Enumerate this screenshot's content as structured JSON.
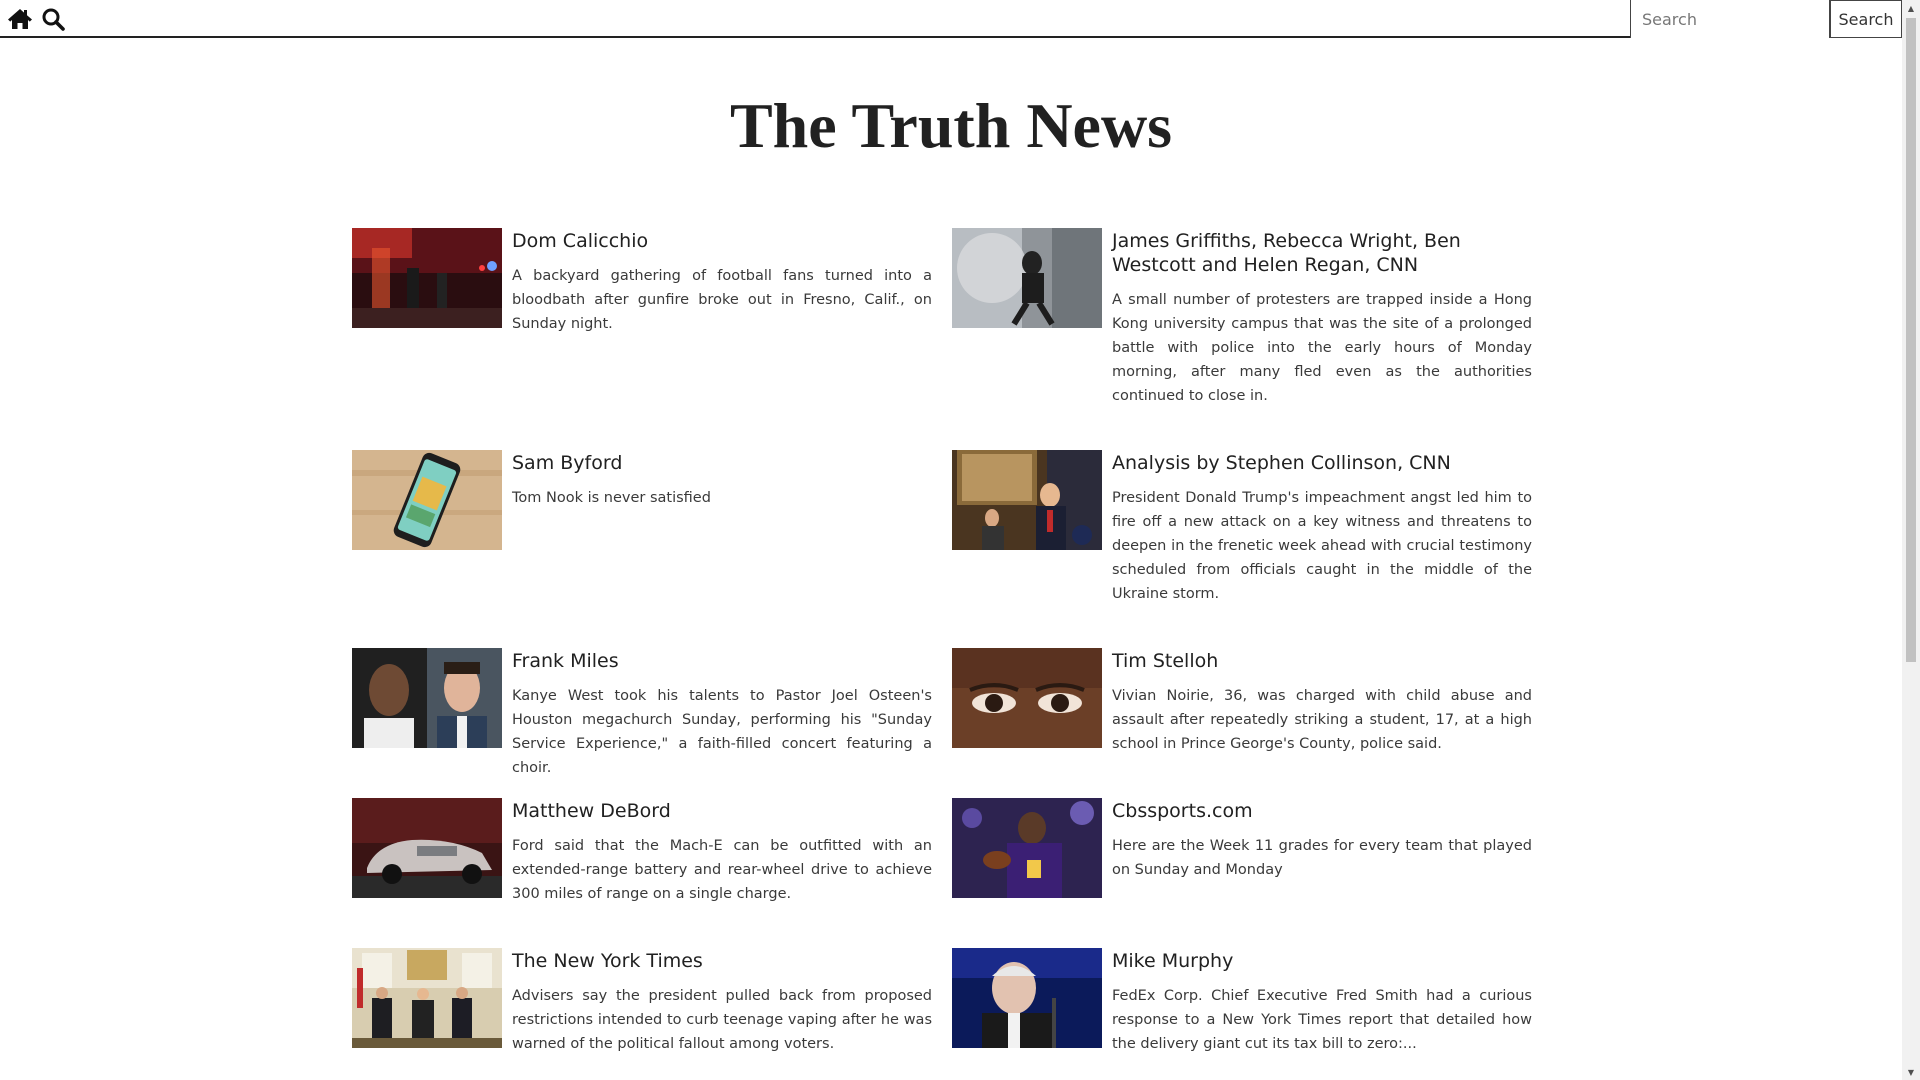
{
  "nav": {
    "home_icon": "home-icon",
    "search_icon": "search-icon",
    "search_placeholder": "Search",
    "search_button": "Search"
  },
  "site_title": "The Truth News",
  "articles": [
    {
      "author": "Dom Calicchio",
      "description": "A backyard gathering of football fans turned into a bloodbath after gunfire broke out in Fresno, Calif., on Sunday night."
    },
    {
      "author": "James Griffiths, Rebecca Wright, Ben Westcott and Helen Regan, CNN",
      "description": "A small number of protesters are trapped inside a Hong Kong university campus that was the site of a prolonged battle with police into the early hours of Monday morning, after many fled even as the authorities continued to close in."
    },
    {
      "author": "Sam Byford",
      "description": "Tom Nook is never satisfied"
    },
    {
      "author": "Analysis by Stephen Collinson, CNN",
      "description": "President Donald Trump's impeachment angst led him to fire off a new attack on a key witness and threatens to deepen in the frenetic week ahead with crucial testimony scheduled from officials caught in the middle of the Ukraine storm."
    },
    {
      "author": "Frank Miles",
      "description": "Kanye West took his talents to Pastor Joel Osteen's Houston megachurch Sunday, performing his \"Sunday Service Experience,\" a faith-filled concert featuring a choir."
    },
    {
      "author": "Tim Stelloh",
      "description": "Vivian Noirie, 36, was charged with child abuse and assault after repeatedly striking a student, 17, at a high school in Prince George's County, police said."
    },
    {
      "author": "Matthew DeBord",
      "description": "Ford said that the Mach-E can be outfitted with an extended-range battery and rear-wheel drive to achieve 300 miles of range on a single charge."
    },
    {
      "author": "Cbssports.com",
      "description": "Here are the Week 11 grades for every team that played on Sunday and Monday"
    },
    {
      "author": "The New York Times",
      "description": "Advisers say the president pulled back from proposed restrictions intended to curb teenage vaping after he was warned of the political fallout among voters."
    },
    {
      "author": "Mike Murphy",
      "description": "FedEx Corp. Chief Executive Fred Smith had a curious response to a New York Times report that detailed how the delivery giant cut its tax bill to zero:..."
    }
  ]
}
